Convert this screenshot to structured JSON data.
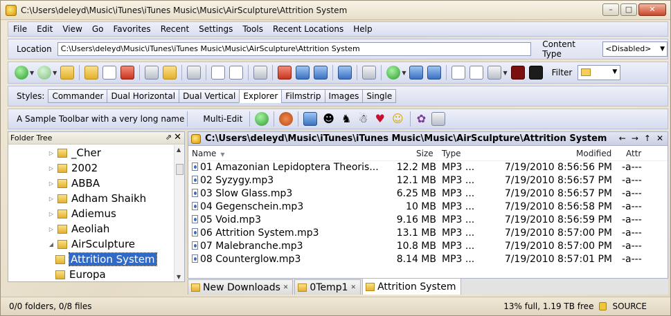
{
  "window": {
    "title": "C:\\Users\\deleyd\\Music\\iTunes\\iTunes Music\\Music\\AirSculpture\\Attrition System",
    "btn_min": "–",
    "btn_max": "□",
    "btn_close": "✕"
  },
  "menu": {
    "items": [
      {
        "label": "File"
      },
      {
        "label": "Edit"
      },
      {
        "label": "View"
      },
      {
        "label": "Go"
      },
      {
        "label": "Favorites"
      },
      {
        "label": "Recent"
      },
      {
        "label": "Settings"
      },
      {
        "label": "Tools"
      },
      {
        "label": "Recent Locations"
      },
      {
        "label": "Help"
      }
    ]
  },
  "location": {
    "label": "Location",
    "value": "C:\\Users\\deleyd\\Music\\iTunes\\iTunes Music\\Music\\AirSculpture\\Attrition System",
    "content_type_label": "Content Type",
    "content_type_value": "<Disabled>"
  },
  "toolbar": {
    "filter_label": "Filter"
  },
  "styles": {
    "label": "Styles:",
    "buttons": [
      "Commander",
      "Dual Horizontal",
      "Dual Vertical",
      "Explorer",
      "Filmstrip",
      "Images",
      "Single"
    ],
    "active": "Explorer"
  },
  "sample_toolbar": {
    "label": "A Sample Toolbar with a very long name",
    "multi_edit": "Multi-Edit"
  },
  "folder_tree": {
    "title": "Folder Tree",
    "items": [
      {
        "label": "_Cher",
        "expander": "▷",
        "indent": 1
      },
      {
        "label": "2002",
        "expander": "▷",
        "indent": 1
      },
      {
        "label": "ABBA",
        "expander": "▷",
        "indent": 1
      },
      {
        "label": "Adham Shaikh",
        "expander": "▷",
        "indent": 1
      },
      {
        "label": "Adiemus",
        "expander": "▷",
        "indent": 1
      },
      {
        "label": "Aeoliah",
        "expander": "▷",
        "indent": 1
      },
      {
        "label": "AirSculpture",
        "expander": "◢",
        "indent": 1
      },
      {
        "label": "Attrition System",
        "expander": "",
        "indent": 2,
        "selected": true
      },
      {
        "label": "Europa",
        "expander": "",
        "indent": 2
      }
    ]
  },
  "file_list": {
    "path": "C:\\Users\\deleyd\\Music\\iTunes\\iTunes Music\\Music\\AirSculpture\\Attrition System",
    "nav": [
      "←",
      "→",
      "↑",
      "✕"
    ],
    "columns": {
      "name": "Name",
      "size": "Size",
      "type": "Type",
      "modified": "Modified",
      "attr": "Attr"
    },
    "rows": [
      {
        "name": "01 Amazonian Lepidoptera Theoris...",
        "size": "12.2 MB",
        "type": "MP3 ...",
        "modified": "7/19/2010 8:56:56 PM",
        "attr": "-a---"
      },
      {
        "name": "02 Syzygy.mp3",
        "size": "12.1 MB",
        "type": "MP3 ...",
        "modified": "7/19/2010 8:56:57 PM",
        "attr": "-a---"
      },
      {
        "name": "03 Slow Glass.mp3",
        "size": "6.25 MB",
        "type": "MP3 ...",
        "modified": "7/19/2010 8:56:57 PM",
        "attr": "-a---"
      },
      {
        "name": "04 Gegenschein.mp3",
        "size": "10 MB",
        "type": "MP3 ...",
        "modified": "7/19/2010 8:56:58 PM",
        "attr": "-a---"
      },
      {
        "name": "05 Void.mp3",
        "size": "9.16 MB",
        "type": "MP3 ...",
        "modified": "7/19/2010 8:56:59 PM",
        "attr": "-a---"
      },
      {
        "name": "06 Attrition System.mp3",
        "size": "13.1 MB",
        "type": "MP3 ...",
        "modified": "7/19/2010 8:57:00 PM",
        "attr": "-a---"
      },
      {
        "name": "07 Malebranche.mp3",
        "size": "10.8 MB",
        "type": "MP3 ...",
        "modified": "7/19/2010 8:57:00 PM",
        "attr": "-a---"
      },
      {
        "name": "08 Counterglow.mp3",
        "size": "8.14 MB",
        "type": "MP3 ...",
        "modified": "7/19/2010 8:57:01 PM",
        "attr": "-a---"
      }
    ]
  },
  "tabs": [
    {
      "label": "New Downloads"
    },
    {
      "label": "0Temp1"
    },
    {
      "label": "Attrition System",
      "active": true
    }
  ],
  "status": {
    "left": "0/0 folders, 0/8 files",
    "disk": "13% full, 1.19 TB free",
    "source": "SOURCE"
  },
  "colors": {
    "selection": "#3169c6",
    "toolbar_bg": "#e3e6f3"
  }
}
